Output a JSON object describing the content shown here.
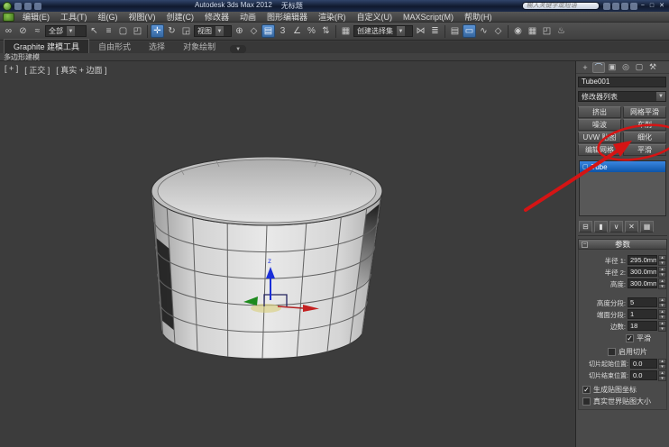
{
  "title_bar": {
    "app_title": "Autodesk 3ds Max 2012",
    "doc_title": "无标题",
    "search_placeholder": "输入关键字或短语"
  },
  "menu_bar": {
    "items": [
      "编辑(E)",
      "工具(T)",
      "组(G)",
      "视图(V)",
      "创建(C)",
      "修改器",
      "动画",
      "图形编辑器",
      "渲染(R)",
      "自定义(U)",
      "MAXScript(M)",
      "帮助(H)"
    ]
  },
  "toolbar": {
    "selection_filter": "全部",
    "coord_system": "视图",
    "named_selection_sets": "创建选择集"
  },
  "ribbon": {
    "tabs": [
      "Graphite 建模工具",
      "自由形式",
      "选择",
      "对象绘制"
    ],
    "active_tab": "Graphite 建模工具",
    "section_label": "多边形建模"
  },
  "viewport": {
    "labels": {
      "menu": "[ + ]",
      "view": "[ 正交 ]",
      "shading": "[ 真实 + 边面 ]"
    },
    "gizmo_z_label": "z"
  },
  "command_panel": {
    "object_name": "Tube001",
    "modifier_list_label": "修改器列表",
    "modifier_buttons": [
      "挤出",
      "网格平滑",
      "噪波",
      "车削",
      "UVW 贴图",
      "细化",
      "编辑网格",
      "平滑"
    ],
    "stack_items": [
      "Tube"
    ],
    "parameters": {
      "title": "参数",
      "collapse_glyph": "−",
      "spinners": [
        {
          "label": "半径 1:",
          "value": "295.0mm"
        },
        {
          "label": "半径 2:",
          "value": "300.0mm"
        },
        {
          "label": "高度:",
          "value": "300.0mm"
        },
        {
          "label": "高度分段:",
          "value": "5"
        },
        {
          "label": "端面分段:",
          "value": "1"
        },
        {
          "label": "边数:",
          "value": "18"
        }
      ],
      "checkboxes": [
        {
          "label": "平滑",
          "checked": true
        },
        {
          "label": "启用切片",
          "checked": false
        },
        {
          "label": "生成贴图坐标",
          "checked": true
        },
        {
          "label": "真实世界贴图大小",
          "checked": false
        }
      ],
      "slice_spinners": [
        {
          "label": "切片起始位置:",
          "value": "0.0"
        },
        {
          "label": "切片结束位置:",
          "value": "0.0"
        }
      ]
    }
  },
  "annotation": {
    "color": "#d51414",
    "target": "细化"
  },
  "colors": {
    "highlight_blue": "#3f74b3",
    "stack_selected": "#1565c0",
    "panel_bg": "#4a4a4a"
  },
  "glyphs": {
    "win_min": "−",
    "win_max": "□",
    "win_close": "✕",
    "link": "∞",
    "unlink": "⊘",
    "bind": "≈",
    "select": "↖",
    "by_name": "≡",
    "region": "▢",
    "window": "◰",
    "move": "✛",
    "rotate": "↻",
    "scale": "◲",
    "pivot": "⊕",
    "manipulate": "◇",
    "keyboard": "▤",
    "snap": "3",
    "angle_snap": "∠",
    "percent_snap": "%",
    "spinner_snap": "⇅",
    "edit_sets": "▦",
    "mirror": "⋈",
    "align": "≣",
    "layers": "▤",
    "graphite": "▭",
    "curve_editor": "∿",
    "schematic": "◇",
    "material": "◉",
    "render_setup": "▦",
    "teapot": "♨",
    "dropdown": "▼",
    "tab_create": "+",
    "tab_modify": "⌒",
    "tab_hierarchy": "▣",
    "tab_motion": "◎",
    "tab_display": "▢",
    "tab_utilities": "⚒",
    "stack_pin": "⊟",
    "stack_show_end": "▮",
    "stack_unique": "∨",
    "stack_remove": "✕",
    "stack_configure": "▦",
    "stack_item_icon": "▢",
    "check": "✓",
    "spin_up": "▴",
    "spin_down": "▾"
  }
}
